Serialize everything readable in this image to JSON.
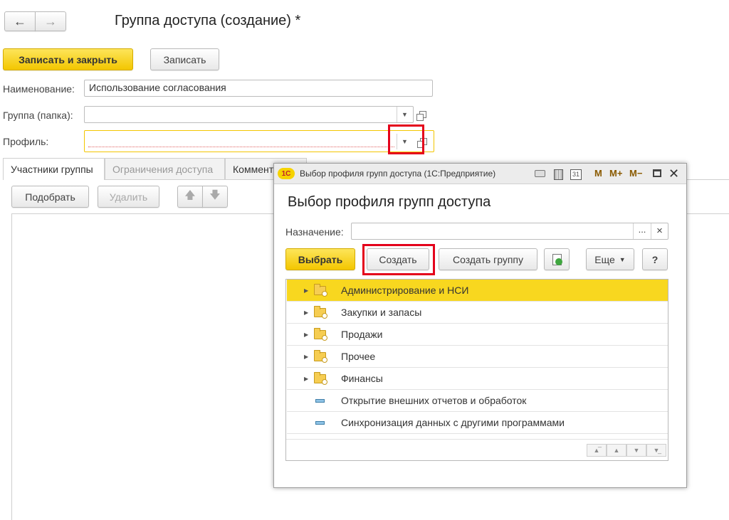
{
  "window": {
    "title": "Группа доступа (создание) *"
  },
  "toolbar": {
    "save_close_label": "Записать и закрыть",
    "save_label": "Записать"
  },
  "form": {
    "name_label": "Наименование:",
    "name_value": "Использование согласования",
    "group_label": "Группа (папка):",
    "group_value": "",
    "profile_label": "Профиль:",
    "profile_value": ""
  },
  "tabs": [
    {
      "label": "Участники группы"
    },
    {
      "label": "Ограничения доступа"
    },
    {
      "label": "Коммент"
    }
  ],
  "members_toolbar": {
    "pick_label": "Подобрать",
    "delete_label": "Удалить"
  },
  "dialog": {
    "window_title": "Выбор профиля групп доступа  (1С:Предприятие)",
    "logo_text": "1С",
    "heading": "Выбор профиля групп доступа",
    "purpose_label": "Назначение:",
    "purpose_value": "",
    "purpose_dots": "...",
    "purpose_clear": "×",
    "select_label": "Выбрать",
    "create_label": "Создать",
    "create_group_label": "Создать группу",
    "more_label": "Еще",
    "help_label": "?",
    "titlebar_tools": [
      "M",
      "M+",
      "M−"
    ],
    "calendar_day": "31",
    "items": [
      {
        "label": "Администрирование и НСИ",
        "type": "folder",
        "selected": true
      },
      {
        "label": "Закупки и запасы",
        "type": "folder"
      },
      {
        "label": "Продажи",
        "type": "folder"
      },
      {
        "label": "Прочее",
        "type": "folder"
      },
      {
        "label": "Финансы",
        "type": "folder"
      },
      {
        "label": "Открытие внешних отчетов и обработок",
        "type": "item"
      },
      {
        "label": "Синхронизация данных с другими программами",
        "type": "item"
      }
    ]
  },
  "colors": {
    "accent_yellow": "#f8d71f",
    "highlight_red": "#e4001b",
    "field_focus": "#f3c600"
  }
}
